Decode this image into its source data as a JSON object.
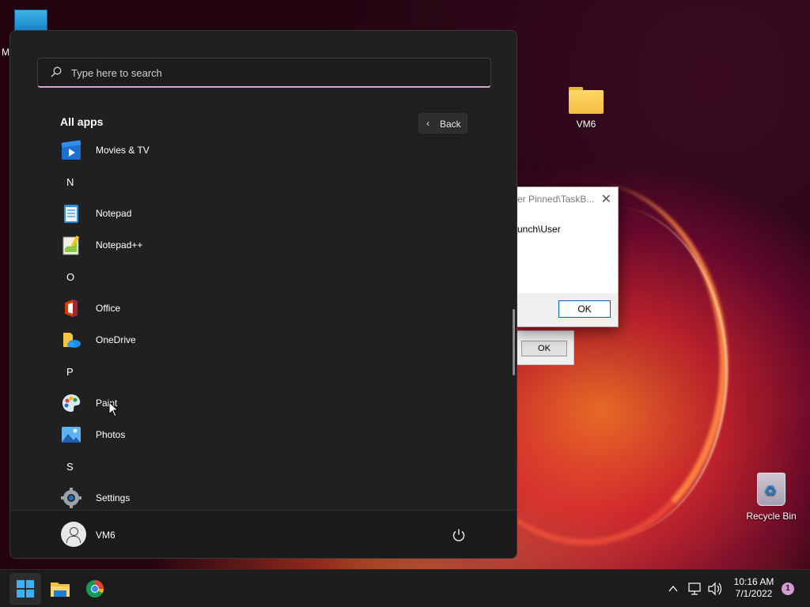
{
  "desktop": {
    "top_left_label": "M",
    "folder_label": "VM6",
    "recycle_bin_label": "Recycle Bin"
  },
  "dialog": {
    "title": "er Pinned\\TaskB...",
    "message": "unch\\User",
    "ok_label": "OK",
    "back_ok_label": "OK",
    "close_glyph": "✕"
  },
  "start_menu": {
    "search_placeholder": "Type here to search",
    "all_apps_label": "All apps",
    "back_label": "Back",
    "back_glyph": "‹",
    "apps": [
      {
        "type": "app",
        "name": "Movies & TV",
        "icon": "movies-tv-icon"
      },
      {
        "type": "letter",
        "name": "N"
      },
      {
        "type": "app",
        "name": "Notepad",
        "icon": "notepad-icon"
      },
      {
        "type": "app",
        "name": "Notepad++",
        "icon": "notepad-plus-plus-icon"
      },
      {
        "type": "letter",
        "name": "O"
      },
      {
        "type": "app",
        "name": "Office",
        "icon": "office-icon"
      },
      {
        "type": "app",
        "name": "OneDrive",
        "icon": "onedrive-icon"
      },
      {
        "type": "letter",
        "name": "P"
      },
      {
        "type": "app",
        "name": "Paint",
        "icon": "paint-icon"
      },
      {
        "type": "app",
        "name": "Photos",
        "icon": "photos-icon"
      },
      {
        "type": "letter",
        "name": "S"
      },
      {
        "type": "app",
        "name": "Settings",
        "icon": "settings-icon"
      }
    ],
    "user_name": "VM6"
  },
  "taskbar": {
    "pinned": [
      "start-button",
      "file-explorer",
      "google-chrome"
    ],
    "tray_chevron": "^",
    "clock_time": "10:16 AM",
    "clock_date": "7/1/2022",
    "notification_count": "1"
  },
  "colors": {
    "menu_bg": "#202020",
    "accent": "#d6a4d4",
    "windows_blue": "#3ab0f5"
  }
}
